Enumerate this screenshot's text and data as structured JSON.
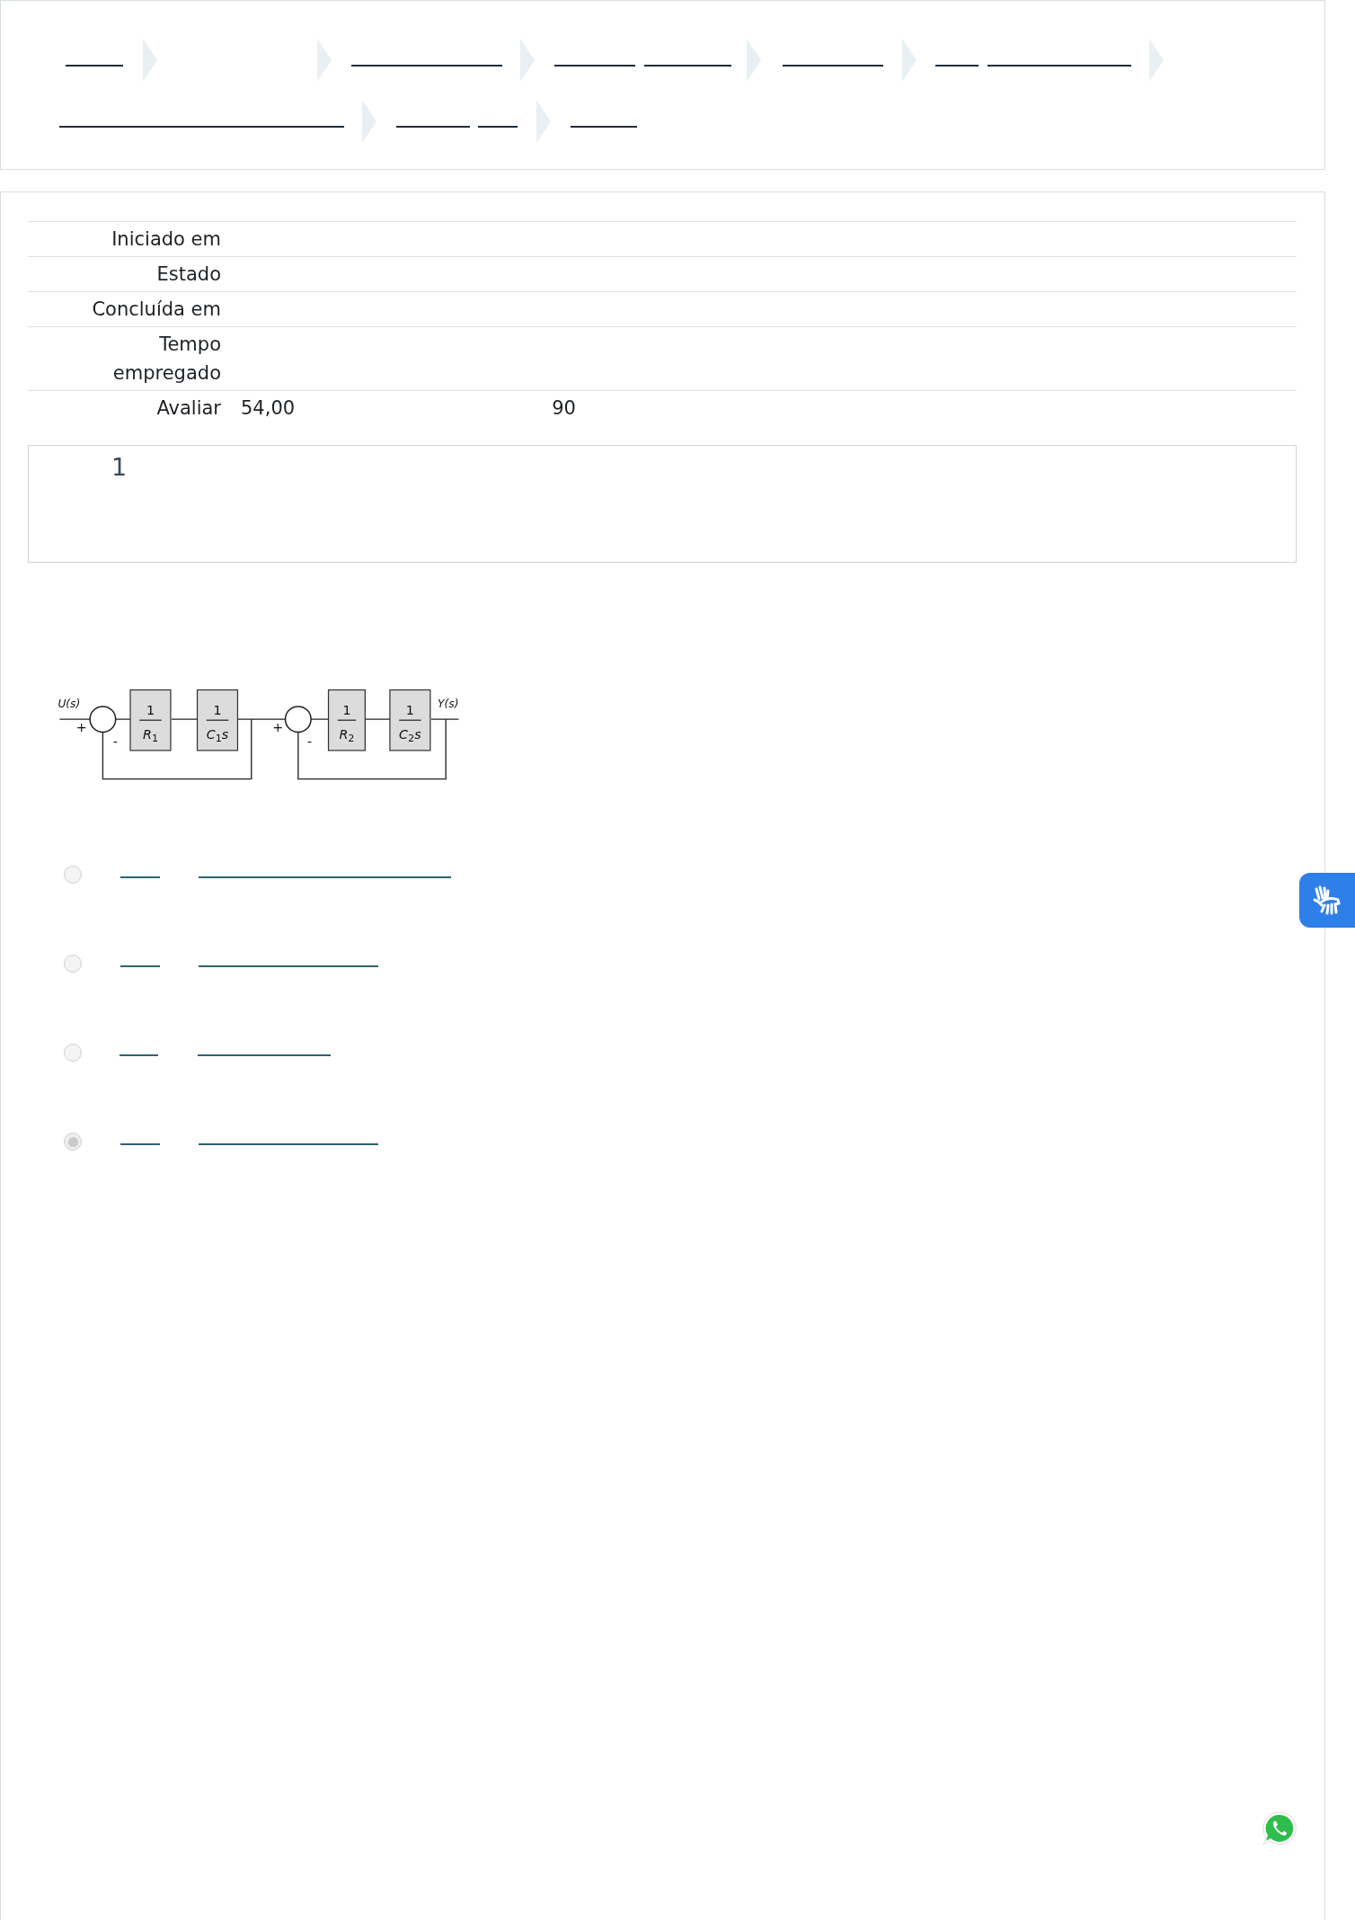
{
  "summary": {
    "rows": [
      {
        "label": "Iniciado em",
        "values": []
      },
      {
        "label": "Estado",
        "values": []
      },
      {
        "label": "Concluída em",
        "values": []
      },
      {
        "label": "Tempo empregado",
        "values": []
      },
      {
        "label": "Avaliar",
        "values": [
          "54,00",
          "90"
        ]
      }
    ]
  },
  "question": {
    "number": "1",
    "diagram": {
      "input": "U(s)",
      "output": "Y(s)",
      "blocks": [
        {
          "numerator": "1",
          "symbol": "R",
          "subscript": "1"
        },
        {
          "numerator": "1",
          "symbol": "C",
          "subscript": "1",
          "suffix": "s"
        },
        {
          "numerator": "1",
          "symbol": "R",
          "subscript": "2"
        },
        {
          "numerator": "1",
          "symbol": "C",
          "subscript": "2",
          "suffix": "s"
        }
      ],
      "signs": [
        "+",
        "-",
        "+",
        "-"
      ]
    },
    "options": [
      {
        "selected": false
      },
      {
        "selected": false
      },
      {
        "selected": false
      },
      {
        "selected": true
      }
    ]
  }
}
